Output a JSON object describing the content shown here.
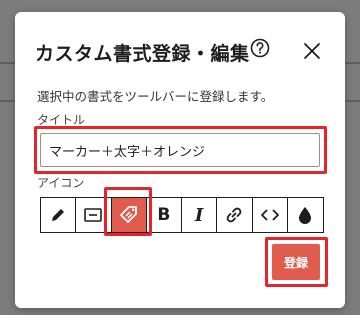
{
  "dialog": {
    "title": "カスタム書式登録・編集",
    "help_icon": "help-circle-icon",
    "close_icon": "close-icon",
    "description": "選択中の書式をツールバーに登録します。",
    "title_label": "タイトル",
    "title_value": "マーカー＋太字＋オレンジ",
    "icon_label": "アイコン",
    "icons": [
      {
        "name": "pencil-icon",
        "selected": false
      },
      {
        "name": "marker-box-icon",
        "selected": false
      },
      {
        "name": "tag-icon",
        "selected": true
      },
      {
        "name": "bold-icon",
        "glyph": "B",
        "selected": false
      },
      {
        "name": "italic-icon",
        "glyph": "I",
        "selected": false
      },
      {
        "name": "link-icon",
        "selected": false
      },
      {
        "name": "code-icon",
        "selected": false
      },
      {
        "name": "drop-icon",
        "selected": false
      }
    ],
    "register_label": "登録"
  },
  "colors": {
    "accent": "#e05d4d",
    "highlight_outline": "#e6242b",
    "overlay": "#7c7c7c"
  }
}
